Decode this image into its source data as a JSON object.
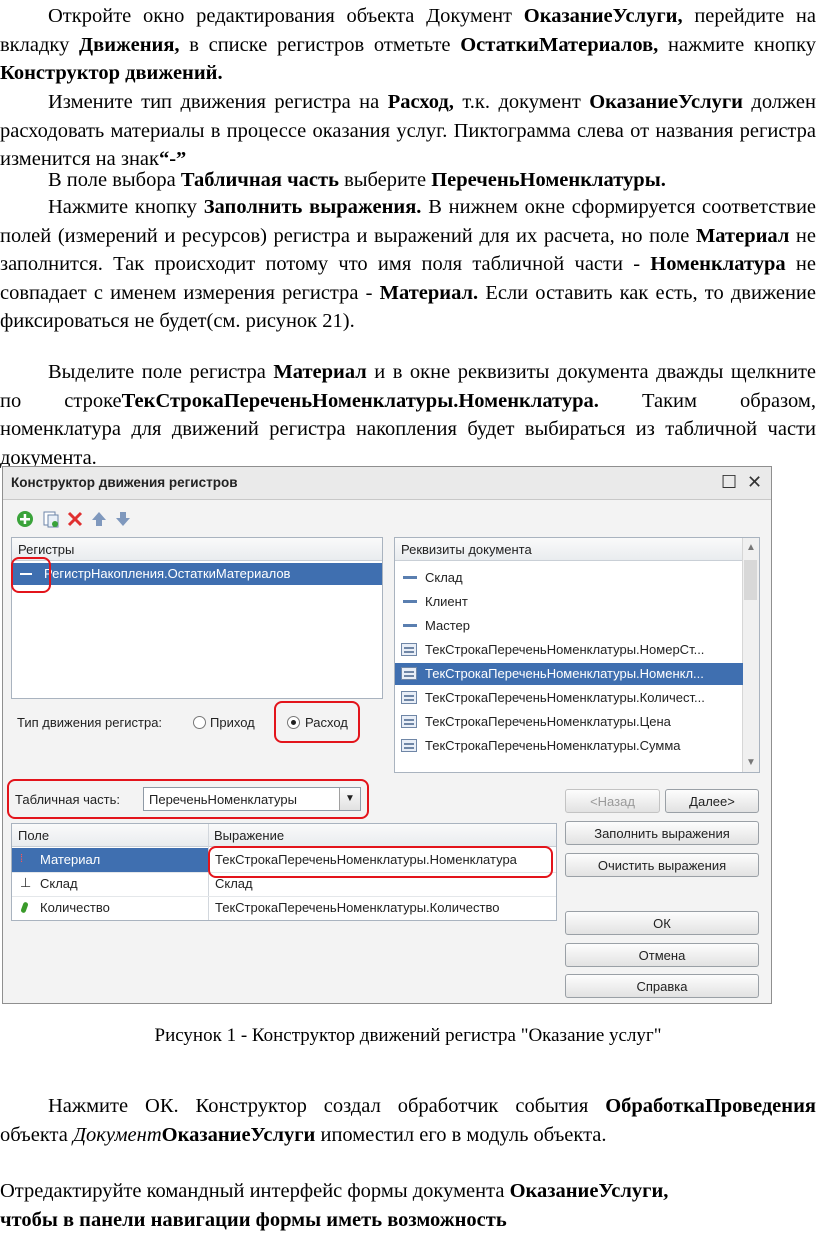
{
  "para1": {
    "t1": "Откройте окно редактирования объекта Документ ",
    "b1": "ОказаниеУслуги,",
    "t2": " перейдите на вкладку ",
    "b2": "Движения,",
    "t3": " в списке регистров отметьте ",
    "b3": "ОстаткиМатериалов,",
    "t4": " нажмите кнопку ",
    "b4": "Конструктор движений."
  },
  "para2": {
    "t1": "Измените тип движения регистра на ",
    "b1": "Расход,",
    "t2": " т.к. документ ",
    "b2": "ОказаниеУслуги",
    "t3": " должен расходовать материалы в процессе оказания услуг. Пиктограмма слева от названия регистра изменится на знак",
    "b3": "“-”"
  },
  "para3": {
    "t1": "В поле выбора ",
    "b1": "Табличная часть",
    "t2": " выберите ",
    "b2": "ПереченьНоменклатуры."
  },
  "para4": {
    "t1": "Нажмите кнопку ",
    "b1": "Заполнить выражения.",
    "t2": " В нижнем окне сформируется соответствие полей (измерений и ресурсов) регистра и выражений для их расчета, но поле ",
    "b2": "Материал",
    "t3": " не заполнится. Так происходит потому что имя поля табличной части - ",
    "b3": "Номенклатура",
    "t4": " не совпадает с именем измерения регистра - ",
    "b4": "Материал.",
    "t5": " Если оставить как есть, то движение фиксироваться не будет(см. рисунок 21)."
  },
  "para5": {
    "t1": "Выделите поле регистра ",
    "b1": "Материал",
    "t2": " и в окне реквизиты документа дважды щелкните по строке",
    "b2": "ТекСтрокаПереченьНоменклатуры.Номенклатура.",
    "t3": " Таким образом, номенклатура для движений регистра накопления будет выбираться из табличной части документа."
  },
  "dialog": {
    "title": "Конструктор движения регистров",
    "registers_header": "Регистры",
    "register_item": "РегистрНакопления.ОстаткиМатериалов",
    "movement_type_label": "Тип движения регистра:",
    "radio_income": "Приход",
    "radio_expense": "Расход",
    "requisites_header": "Реквизиты документа",
    "requisites": [
      "Склад",
      "Клиент",
      "Мастер",
      "ТекСтрокаПереченьНоменклатуры.НомерСт...",
      "ТекСтрокаПереченьНоменклатуры.Номенкл...",
      "ТекСтрокаПереченьНоменклатуры.Количест...",
      "ТекСтрокаПереченьНоменклатуры.Цена",
      "ТекСтрокаПереченьНоменклатуры.Сумма"
    ],
    "table_part_label": "Табличная часть:",
    "table_part_value": "ПереченьНоменклатуры",
    "back_button": "<Назад",
    "next_button": "Далее>",
    "fill_button": "Заполнить выражения",
    "clear_button": "Очистить выражения",
    "ok_button": "ОК",
    "cancel_button": "Отмена",
    "help_button": "Справка",
    "grid_col_field": "Поле",
    "grid_col_expr": "Выражение",
    "grid_rows": [
      {
        "field": "Материал",
        "expr": "ТекСтрокаПереченьНоменклатуры.Номенклатура"
      },
      {
        "field": "Склад",
        "expr": "Склад"
      },
      {
        "field": "Количество",
        "expr": "ТекСтрокаПереченьНоменклатуры.Количество"
      }
    ]
  },
  "caption": "Рисунок 1 - Конструктор движений регистра \"Оказание услуг\"",
  "para6": {
    "t1": "Нажмите ОК. Конструктор создал обработчик события ",
    "b1": "ОбработкаПроведения",
    "t2": " объекта ",
    "i1": "Документ",
    "b2": "ОказаниеУслуги",
    "t3": " ипоместил его в модуль объекта."
  },
  "para7": {
    "t1": "Отредактируйте командный интерфейс формы документа ",
    "b1": "ОказаниеУслуги,",
    "b2": "чтобы в панели навигации формы иметь возможность"
  }
}
